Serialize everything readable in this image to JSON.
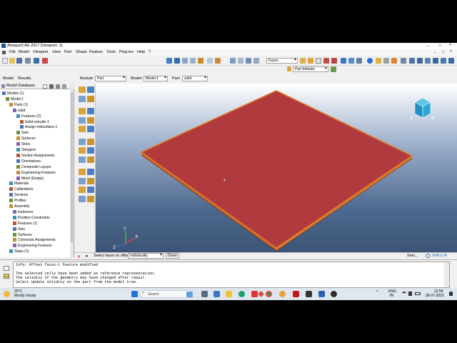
{
  "window": {
    "title": "Abaqus/CAE 2017 [Viewport: 1]",
    "controls": [
      "_",
      "□",
      "×"
    ],
    "inner_controls": [
      "_",
      "□",
      "×"
    ]
  },
  "menubar": {
    "items": [
      "File",
      "Model",
      "Viewport",
      "View",
      "Part",
      "Shape",
      "Feature",
      "Tools",
      "Plug-ins",
      "Help",
      "?"
    ]
  },
  "toolbar": {
    "selection_filter": "Faces",
    "part_defaults": "Part defaults"
  },
  "tabs": [
    "Model",
    "Results"
  ],
  "tree_header": {
    "label": "Model Database"
  },
  "module_row": {
    "module_label": "Module:",
    "module_value": "Part",
    "model_label": "Model:",
    "model_value": "Model-1",
    "part_label": "Part:",
    "part_value": "solid"
  },
  "tree": [
    {
      "label": "Models (1)",
      "indent": 0,
      "icon": "folder-icon"
    },
    {
      "label": "Model-1",
      "indent": 1,
      "icon": "model-icon"
    },
    {
      "label": "Parts (1)",
      "indent": 2,
      "icon": "parts-icon"
    },
    {
      "label": "solid",
      "indent": 3,
      "icon": "part-icon"
    },
    {
      "label": "Features (2)",
      "indent": 4,
      "icon": "features-icon"
    },
    {
      "label": "Solid extrude-1",
      "indent": 5,
      "icon": "extrude-icon"
    },
    {
      "label": "Assign midsurface-1",
      "indent": 5,
      "icon": "midsurface-icon"
    },
    {
      "label": "Sets",
      "indent": 4,
      "icon": "sets-icon"
    },
    {
      "label": "Surfaces",
      "indent": 4,
      "icon": "surfaces-icon"
    },
    {
      "label": "Skins",
      "indent": 4,
      "icon": "skins-icon"
    },
    {
      "label": "Stringers",
      "indent": 4,
      "icon": "stringers-icon"
    },
    {
      "label": "Section Assignments",
      "indent": 4,
      "icon": "section-icon"
    },
    {
      "label": "Orientations",
      "indent": 4,
      "icon": "orientation-icon"
    },
    {
      "label": "Composite Layups",
      "indent": 4,
      "icon": "layup-icon"
    },
    {
      "label": "Engineering Features",
      "indent": 4,
      "icon": "engineering-icon"
    },
    {
      "label": "Mesh (Empty)",
      "indent": 4,
      "icon": "mesh-icon"
    },
    {
      "label": "Materials",
      "indent": 2,
      "icon": "materials-icon"
    },
    {
      "label": "Calibrations",
      "indent": 2,
      "icon": "calibration-icon"
    },
    {
      "label": "Sections",
      "indent": 2,
      "icon": "sections-icon"
    },
    {
      "label": "Profiles",
      "indent": 2,
      "icon": "profiles-icon"
    },
    {
      "label": "Assembly",
      "indent": 2,
      "icon": "assembly-icon"
    },
    {
      "label": "Instances",
      "indent": 3,
      "icon": "instances-icon"
    },
    {
      "label": "Position Constraints",
      "indent": 3,
      "icon": "constraints-icon"
    },
    {
      "label": "Features (1)",
      "indent": 3,
      "icon": "features-icon"
    },
    {
      "label": "Sets",
      "indent": 3,
      "icon": "sets-icon"
    },
    {
      "label": "Surfaces",
      "indent": 3,
      "icon": "surfaces-icon"
    },
    {
      "label": "Connector Assignments",
      "indent": 3,
      "icon": "connector-icon"
    },
    {
      "label": "Engineering Features",
      "indent": 3,
      "icon": "engineering-icon"
    },
    {
      "label": "Steps (1)",
      "indent": 2,
      "icon": "steps-icon"
    }
  ],
  "prompt": {
    "text": "Select faces to offset",
    "mode": "individually",
    "done": "Done",
    "sets": "Sets...",
    "brand": "SIMULIA"
  },
  "messages": [
    "Info: Offset faces-1 feature modified",
    "",
    "The selected cells have been added as reference representation.",
    "The validity of the geometry may have changed after repair.",
    "Select Update Validity on the part from the model tree."
  ],
  "taskbar": {
    "weather_temp": "29°C",
    "weather_desc": "Mostly cloudy",
    "search_placeholder": "Search",
    "lang_top": "ENG",
    "lang_bottom": "IN",
    "time": "12:58",
    "date": "08-07-2023"
  },
  "colors": {
    "plate_top": "#b03a3d",
    "plate_edge": "#e07a2a",
    "simulia": "#2a6fb5"
  }
}
